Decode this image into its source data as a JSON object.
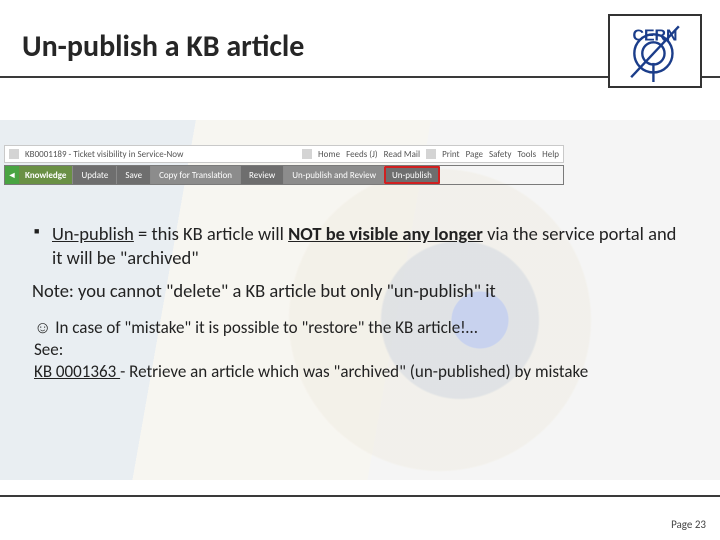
{
  "title": "Un-publish a KB article",
  "logo_text": "CERN",
  "browser_tab": "KB0001189 - Ticket visibility in Service-Now",
  "toolbar1": {
    "home": "Home",
    "feeds": "Feeds (J)",
    "readmail": "Read Mail",
    "print": "Print",
    "page": "Page",
    "safety": "Safety",
    "tools": "Tools",
    "help": "Help"
  },
  "toolbar2": {
    "knowledge": "Knowledge",
    "update": "Update",
    "save": "Save",
    "copy": "Copy for Translation",
    "review": "Review",
    "unpub_review": "Un-publish and Review",
    "unpub": "Un-publish"
  },
  "bullet1": {
    "lead": "Un-publish",
    "mid1": " = this KB article will ",
    "strong": "NOT be visible any longer",
    "mid2": "  via the service portal and it will be \"archived\""
  },
  "note": "Note: you cannot \"delete\" a KB article but only \"un-publish\" it",
  "smile": "☺",
  "restore_line": " In case of \"mistake\" it is possible to \"restore\" the KB article!…",
  "see": "See:",
  "kb_ref": "KB 0001363 ",
  "kb_ref_rest": "- Retrieve an article which was \"archived\" (un-published) by mistake",
  "footer": "Page 23"
}
